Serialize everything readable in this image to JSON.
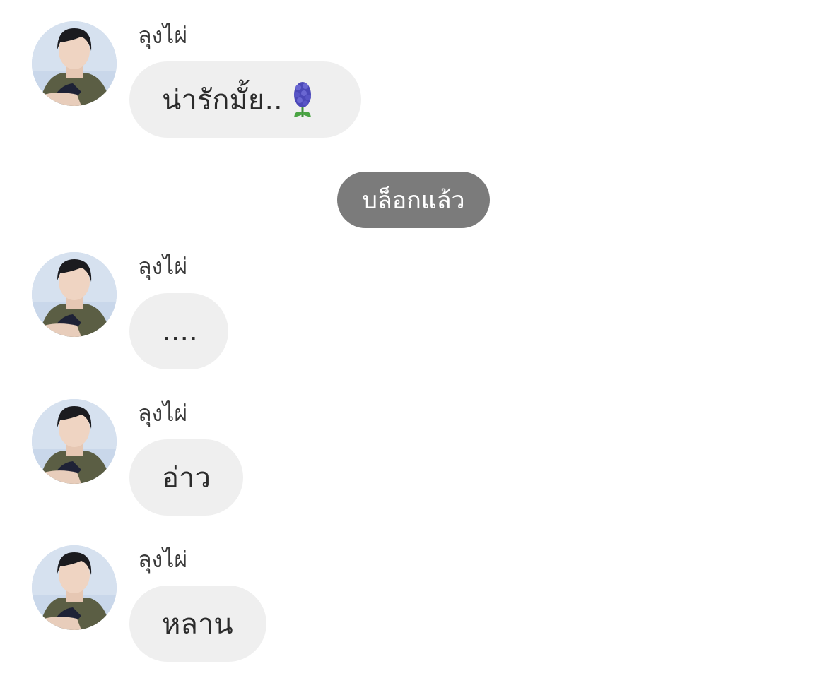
{
  "messages": [
    {
      "sender": "ลุงไผ่",
      "text": "น่ารักมั้ย..",
      "emoji": "hyacinth-icon"
    },
    {
      "sender": "ลุงไผ่",
      "text": "...."
    },
    {
      "sender": "ลุงไผ่",
      "text": "อ่าว"
    },
    {
      "sender": "ลุงไผ่",
      "text": "หลาน"
    }
  ],
  "system_notice": "บล็อกแล้ว",
  "colors": {
    "bubble": "#efefef",
    "system_pill": "#7b7b7b",
    "flower": "#4b48b8"
  }
}
